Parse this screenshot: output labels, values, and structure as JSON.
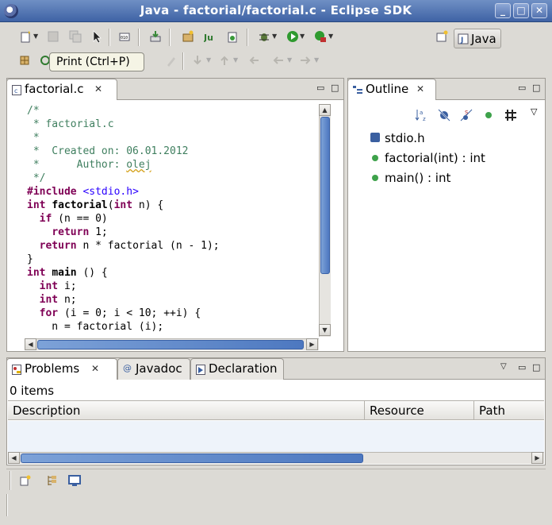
{
  "window": {
    "title": "Java - factorial/factorial.c - Eclipse SDK"
  },
  "toolbar": {
    "tooltip": "Print (Ctrl+P)",
    "perspective": "Java"
  },
  "editor": {
    "tab_label": "factorial.c",
    "lines": [
      [
        {
          "t": "/*",
          "c": "c-com"
        }
      ],
      [
        {
          "t": " * factorial.c",
          "c": "c-com"
        }
      ],
      [
        {
          "t": " *",
          "c": "c-com"
        }
      ],
      [
        {
          "t": " *  Created on: 06.01.2012",
          "c": "c-com"
        }
      ],
      [
        {
          "t": " *      Author: ",
          "c": "c-com"
        },
        {
          "t": "olej",
          "c": "c-com squig"
        }
      ],
      [
        {
          "t": " */",
          "c": "c-com"
        }
      ],
      [
        {
          "t": "#include ",
          "c": "c-pp"
        },
        {
          "t": "<stdio.h>",
          "c": "c-str"
        }
      ],
      [
        {
          "t": "int ",
          "c": "c-kw"
        },
        {
          "t": "factorial",
          "c": "c-fn"
        },
        {
          "t": "("
        },
        {
          "t": "int",
          "c": "c-kw"
        },
        {
          "t": " n) {"
        }
      ],
      [
        {
          "t": "  "
        },
        {
          "t": "if",
          "c": "c-kw"
        },
        {
          "t": " (n == 0)"
        }
      ],
      [
        {
          "t": "    "
        },
        {
          "t": "return",
          "c": "c-kw"
        },
        {
          "t": " 1;"
        }
      ],
      [
        {
          "t": "  "
        },
        {
          "t": "return",
          "c": "c-kw"
        },
        {
          "t": " n * factorial (n - 1);"
        }
      ],
      [
        {
          "t": "}"
        }
      ],
      [
        {
          "t": "int ",
          "c": "c-kw"
        },
        {
          "t": "main",
          "c": "c-fn"
        },
        {
          "t": " () {"
        }
      ],
      [
        {
          "t": "  "
        },
        {
          "t": "int",
          "c": "c-kw"
        },
        {
          "t": " i;"
        }
      ],
      [
        {
          "t": "  "
        },
        {
          "t": "int",
          "c": "c-kw"
        },
        {
          "t": " n;"
        }
      ],
      [
        {
          "t": "  "
        },
        {
          "t": "for",
          "c": "c-kw"
        },
        {
          "t": " (i = 0; i < 10; ++i) {"
        }
      ],
      [
        {
          "t": "    n = factorial (i);"
        }
      ]
    ]
  },
  "outline": {
    "tab_label": "Outline",
    "items": [
      "stdio.h",
      "factorial(int) : int",
      "main() : int"
    ]
  },
  "bottom": {
    "tabs": [
      "Problems",
      "Javadoc",
      "Declaration"
    ],
    "summary": "0 items",
    "columns": [
      "Description",
      "Resource",
      "Path"
    ]
  }
}
